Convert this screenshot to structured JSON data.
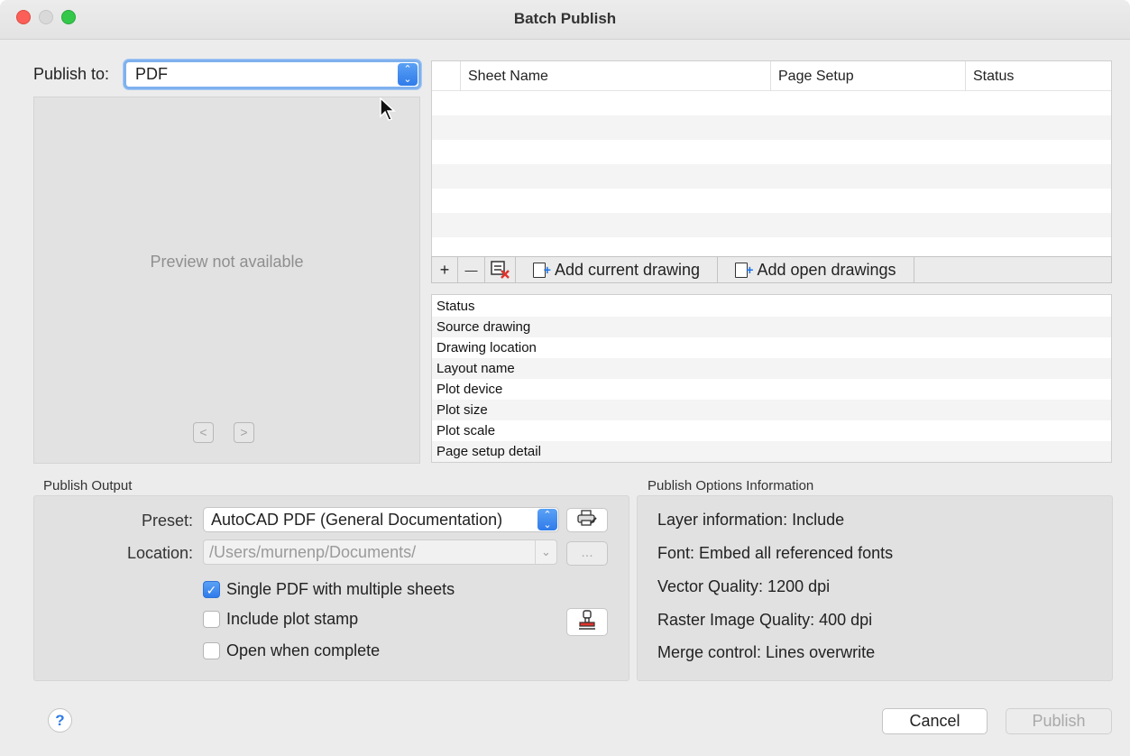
{
  "window": {
    "title": "Batch Publish"
  },
  "publish_to": {
    "label": "Publish to:",
    "value": "PDF"
  },
  "preview": {
    "message": "Preview not available",
    "prev_glyph": "<",
    "next_glyph": ">"
  },
  "sheet_table": {
    "columns": [
      "Sheet Name",
      "Page Setup",
      "Status"
    ],
    "rows": []
  },
  "sheet_toolbar": {
    "add_glyph": "+",
    "remove_glyph": "—",
    "add_current_label": "Add current drawing",
    "add_open_label": "Add open drawings"
  },
  "details": {
    "rows": [
      "Status",
      "Source drawing",
      "Drawing location",
      "Layout name",
      "Plot device",
      "Plot size",
      "Plot scale",
      "Page setup detail"
    ]
  },
  "publish_output": {
    "heading": "Publish Output",
    "preset_label": "Preset:",
    "preset_value": "AutoCAD PDF (General Documentation)",
    "location_label": "Location:",
    "location_value": "/Users/murnenp/Documents/",
    "browse_label": "...",
    "options": [
      {
        "label": "Single PDF with multiple sheets",
        "checked": true
      },
      {
        "label": "Include plot stamp",
        "checked": false
      },
      {
        "label": "Open when complete",
        "checked": false
      }
    ]
  },
  "publish_options_info": {
    "heading": "Publish Options Information",
    "lines": [
      "Layer information: Include",
      "Font: Embed all referenced fonts",
      "Vector Quality: 1200 dpi",
      "Raster Image Quality: 400 dpi",
      "Merge control: Lines overwrite"
    ]
  },
  "footer": {
    "help_glyph": "?",
    "cancel_label": "Cancel",
    "publish_label": "Publish"
  },
  "colors": {
    "accent": "#2f7bea",
    "close": "#fc5f57",
    "maximize": "#34c84a"
  }
}
